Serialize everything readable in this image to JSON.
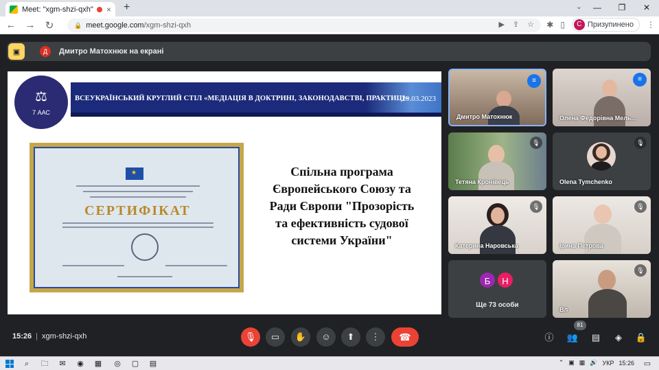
{
  "browser": {
    "tab_title": "Meet: \"xgm-shzi-qxh\"",
    "tab_close": "×",
    "new_tab": "+",
    "url_host": "meet.google.com",
    "url_path": "/xgm-shzi-qxh",
    "profile_initial": "С",
    "profile_status": "Призупинено",
    "window_controls": [
      "—",
      "❐",
      "✕"
    ]
  },
  "meet": {
    "presenter_initial": "Д",
    "presenter_text": "Дмитро Матохнюк на екрані",
    "slide": {
      "logo_text": "7 ААС",
      "banner_title": "ВСЕУКРАЇНСЬКИЙ КРУГЛИЙ СТІЛ «МЕДІАЦІЯ В ДОКТРИНІ, ЗАКОНОДАВСТВІ, ПРАКТИЦІ»",
      "banner_date": "29.03.2023",
      "certificate_title": "СЕРТИФІКАТ",
      "headline": "Спільна програма\nЄвропейського Союзу та\nРади Європи \"Прозорість\nта ефективність судової\nсистеми України\""
    },
    "participants": [
      {
        "name": "Дмитро Матохнюк",
        "state": "speaking"
      },
      {
        "name": "Олена Федорівна Мель...",
        "state": "speaking"
      },
      {
        "name": "Тетяна Кронівець",
        "state": "muted"
      },
      {
        "name": "Olena Tymchenko",
        "state": "muted"
      },
      {
        "name": "Катерина Наровська",
        "state": "muted"
      },
      {
        "name": "Ірина Петрова",
        "state": "muted"
      },
      {
        "name": "Вл",
        "state": "muted"
      }
    ],
    "more": {
      "avatars": [
        {
          "initial": "Б",
          "color": "#9c27b0"
        },
        {
          "initial": "Н",
          "color": "#e91e63"
        }
      ],
      "label": "Ще 73 особи"
    },
    "time": "15:26",
    "meeting_code": "xgm-shzi-qxh",
    "participant_count": "81"
  },
  "taskbar": {
    "lang": "УКР",
    "time": "15:26"
  },
  "colors": {
    "meet_bg": "#202124",
    "end_call": "#ea4335",
    "speaking": "#1a73e8"
  }
}
